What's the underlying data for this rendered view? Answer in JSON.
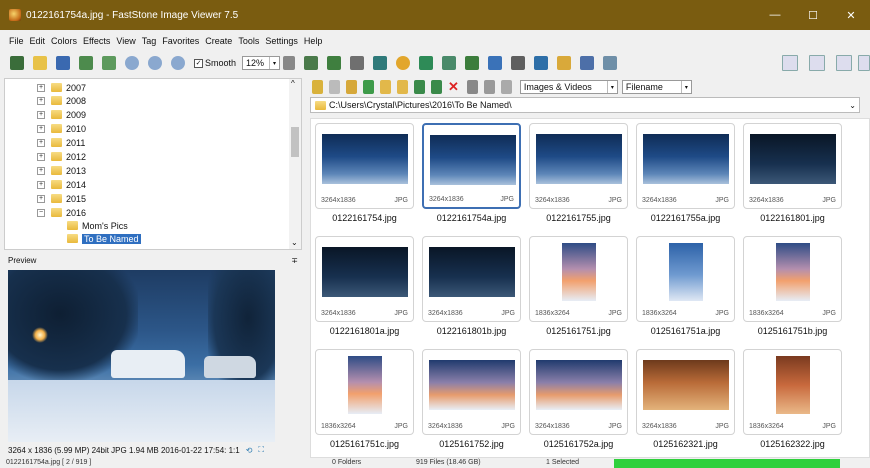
{
  "window": {
    "title": "0122161754a.jpg - FastStone Image Viewer 7.5",
    "minimize": "—",
    "maximize": "☐",
    "close": "✕"
  },
  "menu": [
    "File",
    "Edit",
    "Colors",
    "Effects",
    "View",
    "Tag",
    "Favorites",
    "Create",
    "Tools",
    "Settings",
    "Help"
  ],
  "toolbar": {
    "smooth_label": "Smooth",
    "smooth_checked": true,
    "zoom_value": "12%",
    "zoom_arrow": "▾"
  },
  "tree": {
    "years": [
      "2007",
      "2008",
      "2009",
      "2010",
      "2011",
      "2012",
      "2013",
      "2014",
      "2015",
      "2016"
    ],
    "children": [
      "Mom's Pics",
      "To Be Named"
    ],
    "selected": "To Be Named",
    "scroll_up": "^",
    "scroll_down": "⌄"
  },
  "preview": {
    "header": "Preview",
    "pin": "∓",
    "info": "3264 x 1836 (5.99 MP)  24bit  JPG   1.94 MB   2016-01-22 17:54:  1:1"
  },
  "nav": {
    "filter_value": "Images & Videos",
    "sort_value": "Filename",
    "arrow": "▾"
  },
  "path": "C:\\Users\\Crystal\\Pictures\\2016\\To Be Named\\",
  "thumbnails": [
    {
      "name": "0122161754.jpg",
      "dims": "3264x1836",
      "type": "JPG",
      "kind": "night"
    },
    {
      "name": "0122161754a.jpg",
      "dims": "3264x1836",
      "type": "JPG",
      "kind": "night",
      "selected": true
    },
    {
      "name": "0122161755.jpg",
      "dims": "3264x1836",
      "type": "JPG",
      "kind": "night"
    },
    {
      "name": "0122161755a.jpg",
      "dims": "3264x1836",
      "type": "JPG",
      "kind": "night"
    },
    {
      "name": "0122161801.jpg",
      "dims": "3264x1836",
      "type": "JPG",
      "kind": "dark"
    },
    {
      "name": "0122161801a.jpg",
      "dims": "3264x1836",
      "type": "JPG",
      "kind": "dark"
    },
    {
      "name": "0122161801b.jpg",
      "dims": "3264x1836",
      "type": "JPG",
      "kind": "dark"
    },
    {
      "name": "0125161751.jpg",
      "dims": "1836x3264",
      "type": "JPG",
      "kind": "sunset-tall"
    },
    {
      "name": "0125161751a.jpg",
      "dims": "1836x3264",
      "type": "JPG",
      "kind": "sky-tall"
    },
    {
      "name": "0125161751b.jpg",
      "dims": "1836x3264",
      "type": "JPG",
      "kind": "sunset-tall"
    },
    {
      "name": "0125161751c.jpg",
      "dims": "1836x3264",
      "type": "JPG",
      "kind": "sunset-tall"
    },
    {
      "name": "0125161752.jpg",
      "dims": "3264x1836",
      "type": "JPG",
      "kind": "sunset"
    },
    {
      "name": "0125161752a.jpg",
      "dims": "3264x1836",
      "type": "JPG",
      "kind": "sunset"
    },
    {
      "name": "0125162321.jpg",
      "dims": "3264x1836",
      "type": "JPG",
      "kind": "warm"
    },
    {
      "name": "0125162322.jpg",
      "dims": "1836x3264",
      "type": "JPG",
      "kind": "warm-tall"
    }
  ],
  "status": {
    "file": "0122161754a.jpg [ 2 / 919 ]",
    "folders": "0 Folders",
    "files": "919 Files (18.46 GB)",
    "selected": "1 Selected"
  },
  "colors": {
    "titlebar": "#7a5c10",
    "selection": "#2f6fc0",
    "progress": "#2fd03c"
  }
}
